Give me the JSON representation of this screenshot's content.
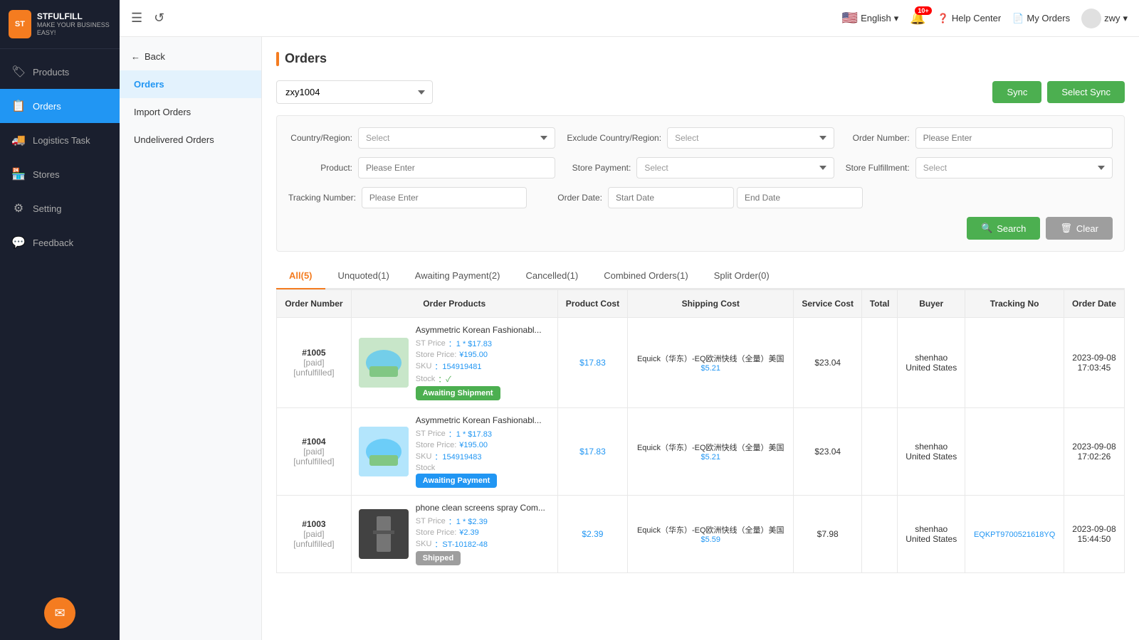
{
  "app": {
    "name": "STFULFILL",
    "tagline": "MAKE YOUR BUSINESS EASY!"
  },
  "topbar": {
    "language": "English",
    "notification_count": "10+",
    "help_label": "Help Center",
    "orders_label": "My Orders",
    "user": "zwy",
    "refresh_icon": "↺",
    "menu_icon": "☰"
  },
  "sidebar": {
    "items": [
      {
        "id": "products",
        "label": "Products",
        "icon": "🏷"
      },
      {
        "id": "orders",
        "label": "Orders",
        "icon": "📋",
        "active": true
      },
      {
        "id": "logistics",
        "label": "Logistics Task",
        "icon": "🚚"
      },
      {
        "id": "stores",
        "label": "Stores",
        "icon": "🏪"
      },
      {
        "id": "setting",
        "label": "Setting",
        "icon": "⚙"
      },
      {
        "id": "feedback",
        "label": "Feedback",
        "icon": "💬"
      }
    ]
  },
  "sub_sidebar": {
    "back_label": "Back",
    "items": [
      {
        "id": "orders",
        "label": "Orders",
        "active": true
      },
      {
        "id": "import-orders",
        "label": "Import Orders"
      },
      {
        "id": "undelivered",
        "label": "Undelivered Orders"
      }
    ]
  },
  "page": {
    "title": "Orders",
    "store_value": "zxy1004",
    "sync_label": "Sync",
    "select_sync_label": "Select Sync"
  },
  "filters": {
    "country_label": "Country/Region:",
    "country_placeholder": "Select",
    "exclude_country_label": "Exclude Country/Region:",
    "exclude_country_placeholder": "Select",
    "order_number_label": "Order Number:",
    "order_number_placeholder": "Please Enter",
    "product_label": "Product:",
    "product_placeholder": "Please Enter",
    "store_payment_label": "Store Payment:",
    "store_payment_placeholder": "Select",
    "store_fulfillment_label": "Store Fulfillment:",
    "store_fulfillment_placeholder": "Select",
    "tracking_label": "Tracking Number:",
    "tracking_placeholder": "Please Enter",
    "order_date_label": "Order Date:",
    "start_date_placeholder": "Start Date",
    "end_date_placeholder": "End Date",
    "search_label": "Search",
    "clear_label": "Clear"
  },
  "tabs": [
    {
      "id": "all",
      "label": "All(5)",
      "active": true
    },
    {
      "id": "unquoted",
      "label": "Unquoted(1)"
    },
    {
      "id": "awaiting-payment",
      "label": "Awaiting Payment(2)"
    },
    {
      "id": "cancelled",
      "label": "Cancelled(1)"
    },
    {
      "id": "combined",
      "label": "Combined Orders(1)"
    },
    {
      "id": "split",
      "label": "Split Order(0)"
    }
  ],
  "table": {
    "headers": [
      "Order Number",
      "Order Products",
      "Product Cost",
      "Shipping Cost",
      "Service Cost",
      "Total",
      "Buyer",
      "Tracking No",
      "Order Date"
    ],
    "rows": [
      {
        "order_number": "#1005",
        "order_status1": "[paid]",
        "order_status2": "[unfulfilled]",
        "product_name": "Asymmetric Korean Fashionabl...",
        "st_price_label": "ST Price",
        "st_price_val": "：1 * $17.83",
        "store_price_label": "Store Price:",
        "store_price_val": "¥195.00",
        "sku_label": "SKU",
        "sku_val": "：154919481",
        "stock_label": "Stock",
        "stock_val": "：✓",
        "badge": "Awaiting Shipment",
        "badge_type": "awaiting-shipment",
        "product_cost": "$17.83",
        "shipping_carrier": "Equick（华东）-EQ欧洲快线（全量）美国",
        "shipping_price": "$5.21",
        "service_cost": "$23.04",
        "total": "",
        "buyer": "shenhao",
        "buyer_country": "United States",
        "tracking_no": "",
        "order_date": "2023-09-08",
        "order_time": "17:03:45",
        "has_image": true
      },
      {
        "order_number": "#1004",
        "order_status1": "[paid]",
        "order_status2": "[unfulfilled]",
        "product_name": "Asymmetric Korean Fashionabl...",
        "st_price_label": "ST Price",
        "st_price_val": "：1 * $17.83",
        "store_price_label": "Store Price:",
        "store_price_val": "¥195.00",
        "sku_label": "SKU",
        "sku_val": "：154919483",
        "stock_label": "Stock",
        "stock_val": "",
        "badge": "Awaiting Payment",
        "badge_type": "awaiting-payment",
        "product_cost": "$17.83",
        "shipping_carrier": "Equick（华东）-EQ欧洲快线（全量）美国",
        "shipping_price": "$5.21",
        "service_cost": "$23.04",
        "total": "",
        "buyer": "shenhao",
        "buyer_country": "United States",
        "tracking_no": "",
        "order_date": "2023-09-08",
        "order_time": "17:02:26",
        "has_image": true
      },
      {
        "order_number": "#1003",
        "order_status1": "[paid]",
        "order_status2": "[unfulfilled]",
        "product_name": "phone clean screens spray Com...",
        "st_price_label": "ST Price",
        "st_price_val": "：1 * $2.39",
        "store_price_label": "Store Price:",
        "store_price_val": "¥2.39",
        "sku_label": "SKU",
        "sku_val": "：ST-10182-48",
        "stock_label": "",
        "stock_val": "",
        "badge": "Shipped",
        "badge_type": "shipped",
        "product_cost": "$2.39",
        "shipping_carrier": "Equick（华东）-EQ欧洲快线（全量）美国",
        "shipping_price": "$5.59",
        "service_cost": "$7.98",
        "total": "",
        "buyer": "shenhao",
        "buyer_country": "United States",
        "tracking_no": "EQKPT9700521618YQ",
        "order_date": "2023-09-08",
        "order_time": "15:44:50",
        "has_image": true
      }
    ]
  }
}
